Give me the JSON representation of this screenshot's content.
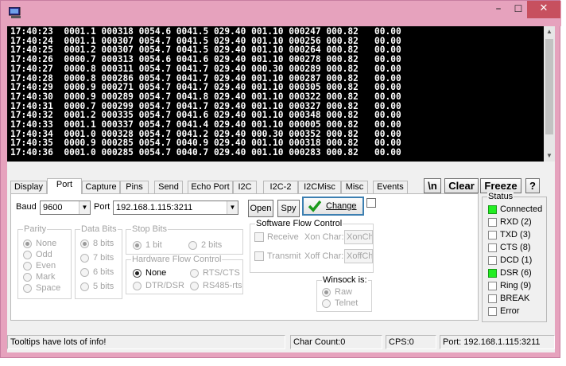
{
  "window": {
    "title_buttons": {
      "minimize": "–",
      "maximize": "☐",
      "close": "✕"
    }
  },
  "terminal": {
    "lines": [
      "17:40:23  0001.1 000318 0054.6 0041.5 029.40 001.10 000247 000.82   00.00",
      "17:40:24  0001.1 000307 0054.7 0041.5 029.40 001.10 000256 000.82   00.00",
      "17:40:25  0001.2 000307 0054.7 0041.5 029.40 001.10 000264 000.82   00.00",
      "17:40:26  0000.7 000313 0054.6 0041.6 029.40 001.10 000278 000.82   00.00",
      "17:40:27  0000.8 000311 0054.7 0041.7 029.40 000.30 000289 000.82   00.00",
      "17:40:28  0000.8 000286 0054.7 0041.7 029.40 001.10 000287 000.82   00.00",
      "17:40:29  0000.9 000271 0054.7 0041.7 029.40 001.10 000305 000.82   00.00",
      "17:40:30  0000.9 000289 0054.7 0041.8 029.40 001.10 000322 000.82   00.00",
      "17:40:31  0000.7 000299 0054.7 0041.7 029.40 001.10 000327 000.82   00.00",
      "17:40:32  0001.2 000335 0054.7 0041.6 029.40 001.10 000348 000.82   00.00",
      "17:40:33  0001.1 000337 0054.7 0041.4 029.40 001.10 000005 000.82   00.00",
      "17:40:34  0001.0 000328 0054.7 0041.2 029.40 000.30 000352 000.82   00.00",
      "17:40:35  0000.9 000285 0054.7 0040.9 029.40 001.10 000318 000.82   00.00",
      "17:40:36  0001.0 000285 0054.7 0040.7 029.40 001.10 000283 000.82   00.00"
    ]
  },
  "tabs": [
    "Display",
    "Port",
    "Capture",
    "Pins",
    "Send",
    "Echo Port",
    "I2C",
    "I2C-2",
    "I2CMisc",
    "Misc",
    "Events"
  ],
  "toolbar": {
    "newline_label": "\\n",
    "clear_label": "Clear",
    "freeze_label": "Freeze",
    "help_label": "?"
  },
  "port": {
    "baud_label": "Baud",
    "baud_value": "9600",
    "port_label": "Port",
    "port_value": "192.168.1.115:3211",
    "open_label": "Open",
    "spy_label": "Spy",
    "change_label": "Change"
  },
  "parity": {
    "title": "Parity",
    "options": [
      "None",
      "Odd",
      "Even",
      "Mark",
      "Space"
    ]
  },
  "data_bits": {
    "title": "Data Bits",
    "options": [
      "8 bits",
      "7 bits",
      "6 bits",
      "5 bits"
    ]
  },
  "stop_bits": {
    "title": "Stop Bits",
    "options": [
      "1 bit",
      "2 bits"
    ]
  },
  "hw_flow": {
    "title": "Hardware Flow Control",
    "options": [
      "None",
      "RTS/CTS",
      "DTR/DSR",
      "RS485-rts"
    ]
  },
  "sw_flow": {
    "title": "Software Flow Control",
    "receive_label": "Receive",
    "transmit_label": "Transmit",
    "xon_label": "Xon Char:",
    "xoff_label": "Xoff Char:",
    "xon_value": "XonCh",
    "xoff_value": "XoffCh"
  },
  "winsock": {
    "title": "Winsock is:",
    "options": [
      "Raw",
      "Telnet"
    ]
  },
  "status": {
    "title": "Status",
    "items": [
      {
        "label": "Connected",
        "on": true
      },
      {
        "label": "RXD (2)",
        "on": false
      },
      {
        "label": "TXD (3)",
        "on": false
      },
      {
        "label": "CTS (8)",
        "on": false
      },
      {
        "label": "DCD (1)",
        "on": false
      },
      {
        "label": "DSR (6)",
        "on": true
      },
      {
        "label": "Ring (9)",
        "on": false
      },
      {
        "label": "BREAK",
        "on": false
      },
      {
        "label": "Error",
        "on": false
      }
    ]
  },
  "statusbar": {
    "tip": "Tooltips have lots of info!",
    "char_count": "Char Count:0",
    "cps": "CPS:0",
    "port": "Port: 192.168.1.115:3211"
  }
}
